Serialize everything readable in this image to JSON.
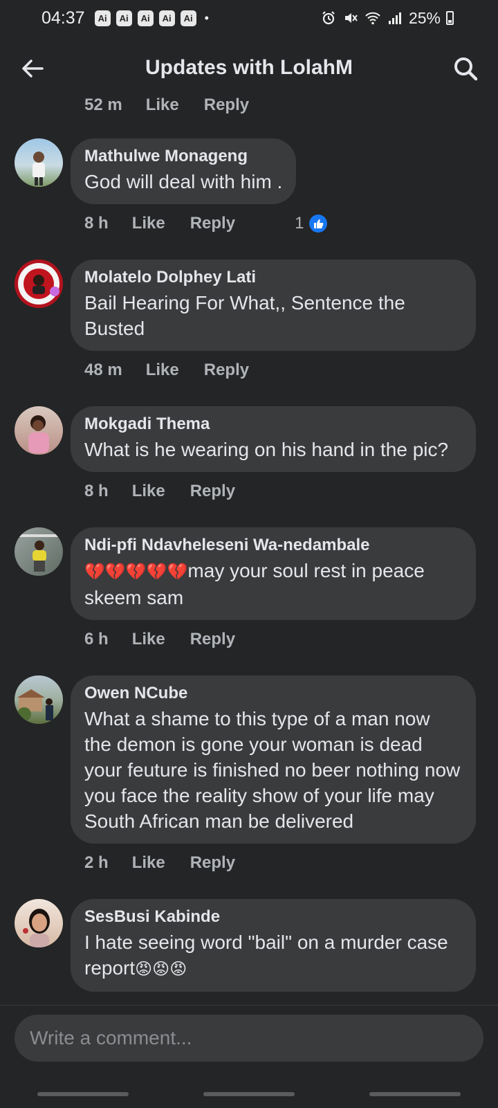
{
  "status_bar": {
    "time": "04:37",
    "badges": [
      "Ai",
      "Ai",
      "Ai",
      "Ai",
      "Ai"
    ],
    "dot": "•",
    "battery": "25%",
    "icons": [
      "alarm-icon",
      "mute-icon",
      "wifi-icon",
      "signal-icon",
      "battery-icon"
    ]
  },
  "header": {
    "title": "Updates with LolahM",
    "back_icon": "back-arrow-icon",
    "search_icon": "search-icon"
  },
  "top_meta": {
    "time": "52 m",
    "like": "Like",
    "reply": "Reply"
  },
  "comments": [
    {
      "author": "Mathulwe Monageng",
      "text": "God will deal with him .",
      "time": "8 h",
      "like": "Like",
      "reply": "Reply",
      "likes_count": "1"
    },
    {
      "author": "Molatelo Dolphey Lati",
      "text": "Bail Hearing For What,, Sentence the Busted",
      "time": "48 m",
      "like": "Like",
      "reply": "Reply"
    },
    {
      "author": "Mokgadi Thema",
      "text": "What is he wearing on his hand in the pic?",
      "time": "8 h",
      "like": "Like",
      "reply": "Reply"
    },
    {
      "author": "Ndi-pfi Ndavheleseni Wa-nedambale",
      "emojis": "💔💔💔💔💔",
      "text": "may your soul rest in peace skeem sam",
      "time": "6 h",
      "like": "Like",
      "reply": "Reply"
    },
    {
      "author": "Owen NCube",
      "text": "What a shame to this type of a man now the demon is gone your woman is dead your feuture is finished no beer nothing now you face the reality show of your life may South African man be delivered",
      "time": "2 h",
      "like": "Like",
      "reply": "Reply"
    },
    {
      "author": "SesBusi Kabinde",
      "text": "I hate seeing  word \"bail\" on a murder case report",
      "emojis": "😡😡😡"
    }
  ],
  "composer": {
    "placeholder": "Write a comment..."
  },
  "colors": {
    "background": "#242526",
    "bubble": "#3a3b3c",
    "accent": "#1877f2",
    "muted": "#b0b3b8"
  }
}
